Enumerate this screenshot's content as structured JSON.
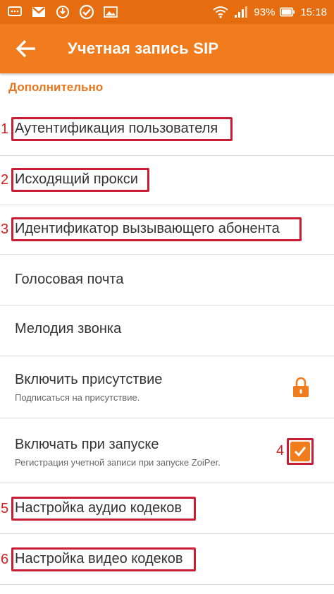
{
  "status_bar": {
    "battery": "93%",
    "time": "15:18",
    "left_icons": [
      "chat-icon",
      "gmail-icon",
      "sync-icon",
      "check-circle-icon",
      "image-icon"
    ],
    "right_icons": [
      "wifi-icon",
      "signal-icon",
      "battery-icon"
    ]
  },
  "app_bar": {
    "title": "Учетная запись SIP",
    "back_icon": "arrow-back-icon"
  },
  "section": {
    "title": "Дополнительно"
  },
  "items": [
    {
      "title": "Аутентификация пользователя",
      "marker": "1"
    },
    {
      "title": "Исходящий прокси",
      "marker": "2"
    },
    {
      "title": "Идентификатор вызывающего абонента",
      "marker": "3"
    },
    {
      "title": "Голосовая почта"
    },
    {
      "title": "Мелодия звонка"
    },
    {
      "title": "Включить присутствие",
      "subtitle": "Подписаться на присутствие.",
      "trailing": "lock-icon"
    },
    {
      "title": "Включать при запуске",
      "subtitle": "Регистрация учетной записи при запуске ZoiPer.",
      "trailing": "checkbox",
      "checked": true,
      "marker": "4"
    },
    {
      "title": "Настройка аудио кодеков",
      "marker": "5"
    },
    {
      "title": "Настройка видео кодеков",
      "marker": "6"
    }
  ],
  "colors": {
    "status_bar": "#e56d10",
    "app_bar": "#f07c1d",
    "section_header": "#e8761e",
    "annotation": "#c81e35"
  }
}
